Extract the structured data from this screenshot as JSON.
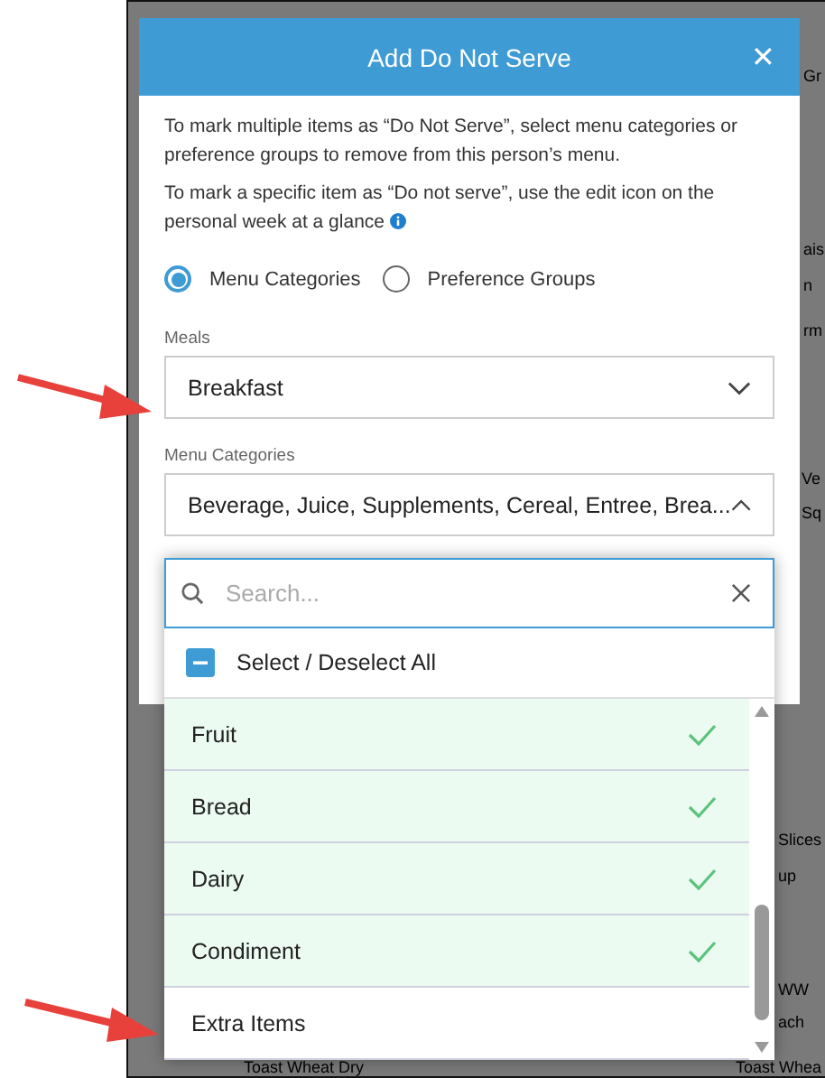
{
  "background": {
    "fragments": [
      "Gr",
      "ais",
      "n",
      "rm",
      "Ve",
      "Sq",
      "Slices",
      "up",
      "WW",
      "ach"
    ],
    "bottom_row": [
      "Toast Wheat Dry",
      "Toast Whea"
    ]
  },
  "dialog": {
    "title": "Add Do Not Serve",
    "close": "✕",
    "intro": [
      "To mark multiple items as “Do Not Serve”, select menu categories or preference groups to remove from this person’s menu.",
      "To mark a specific item as “Do not serve”, use the edit icon on the personal week at a glance"
    ],
    "modes": [
      {
        "label": "Menu Categories",
        "selected": true
      },
      {
        "label": "Preference Groups",
        "selected": false
      }
    ],
    "meals": {
      "label": "Meals",
      "value": "Breakfast"
    },
    "categories": {
      "label": "Menu Categories",
      "value": "Beverage, Juice, Supplements, Cereal, Entree, Brea...",
      "expanded": true
    },
    "search": {
      "placeholder": "Search..."
    },
    "select_all": {
      "label": "Select / Deselect All"
    },
    "options": [
      {
        "label": "Fruit",
        "checked": true
      },
      {
        "label": "Bread",
        "checked": true
      },
      {
        "label": "Dairy",
        "checked": true
      },
      {
        "label": "Condiment",
        "checked": true
      },
      {
        "label": "Extra Items",
        "checked": false
      }
    ]
  }
}
